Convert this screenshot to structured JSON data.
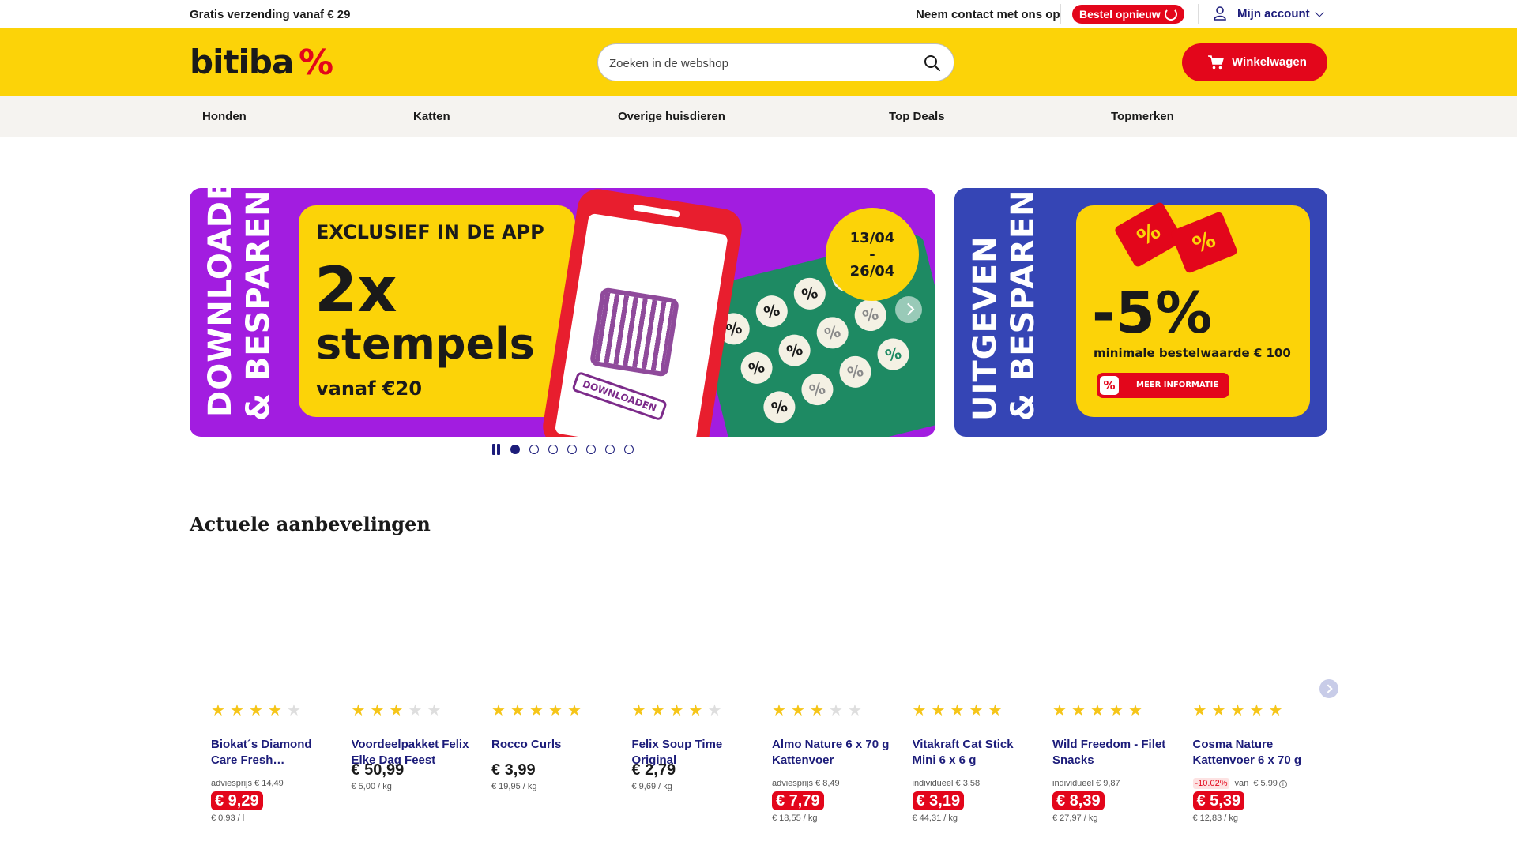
{
  "topbar": {
    "shipping": "Gratis verzending vanaf € 29",
    "contact": "Neem contact met ons op",
    "reorder": "Bestel opnieuw",
    "account": "Mijn account"
  },
  "header": {
    "logo_text": "bitiba",
    "logo_symbol": "%",
    "search_placeholder": "Zoeken in de webshop",
    "cart_label": "Winkelwagen"
  },
  "nav": {
    "items": [
      "Honden",
      "Katten",
      "Overige huisdieren",
      "Top Deals",
      "Topmerken"
    ]
  },
  "banner_main": {
    "side_text_1": "DOWNLOADEN",
    "side_text_2": "& BESPAREN",
    "kicker": "EXCLUSIEF IN DE APP",
    "headline_1": "2x",
    "headline_2": "stempels",
    "subline": "vanaf €20",
    "qr_label": "DOWNLOADEN",
    "date_from": "13/04",
    "date_sep": "-",
    "date_to": "26/04"
  },
  "banner_side": {
    "side_text_1": "UITGEVEN",
    "side_text_2": "& BESPAREN",
    "discount": "-5%",
    "condition": "minimale bestelwaarde € 100",
    "button": "MEER INFORMATIE"
  },
  "carousel": {
    "slides": 7,
    "active": 1
  },
  "recommendations": {
    "title": "Actuele aanbevelingen",
    "products": [
      {
        "name": "Biokat´s Diamond Care Fresh…",
        "rating": 4,
        "ref_label": "adviesprijs € 14,49",
        "price": "€ 9,29",
        "unit": "€ 0,93 / l",
        "promo": true
      },
      {
        "name": "Voordeelpakket Felix Elke Dag Feest 120…",
        "rating": 3,
        "ref_label": "",
        "price": "€ 50,99",
        "unit": "€ 5,00 / kg",
        "promo": false
      },
      {
        "name": "Rocco Curls",
        "rating": 5,
        "ref_label": "",
        "price": "€ 3,99",
        "unit": "€ 19,95 / kg",
        "promo": false
      },
      {
        "name": "Felix Soup Time Original",
        "rating": 4,
        "ref_label": "",
        "price": "€ 2,79",
        "unit": "€ 9,69 / kg",
        "promo": false
      },
      {
        "name": "Almo Nature 6 x 70 g Kattenvoer",
        "rating": 3,
        "ref_label": "adviesprijs € 8,49",
        "price": "€ 7,79",
        "unit": "€ 18,55 / kg",
        "promo": true
      },
      {
        "name": "Vitakraft Cat Stick Mini 6 x 6 g",
        "rating": 5,
        "ref_label": "individueel € 3,58",
        "price": "€ 3,19",
        "unit": "€ 44,31 / kg",
        "promo": true
      },
      {
        "name": "Wild Freedom - Filet Snacks",
        "rating": 5,
        "ref_label": "individueel € 9,87",
        "price": "€ 8,39",
        "unit": "€ 27,97 / kg",
        "promo": true
      },
      {
        "name": "Cosma Nature Kattenvoer 6 x 70 g",
        "rating": 5,
        "discount": "-10.02%",
        "ref_prefix": "van",
        "ref_price": "€ 5,99",
        "price": "€ 5,39",
        "unit": "€ 12,83 / kg",
        "promo": true
      }
    ]
  },
  "colors": {
    "brand_yellow": "#fcd308",
    "brand_red": "#e3061b",
    "navy": "#1c1c7a",
    "banner_purple": "#a21de0",
    "banner_blue": "#3545b5"
  }
}
